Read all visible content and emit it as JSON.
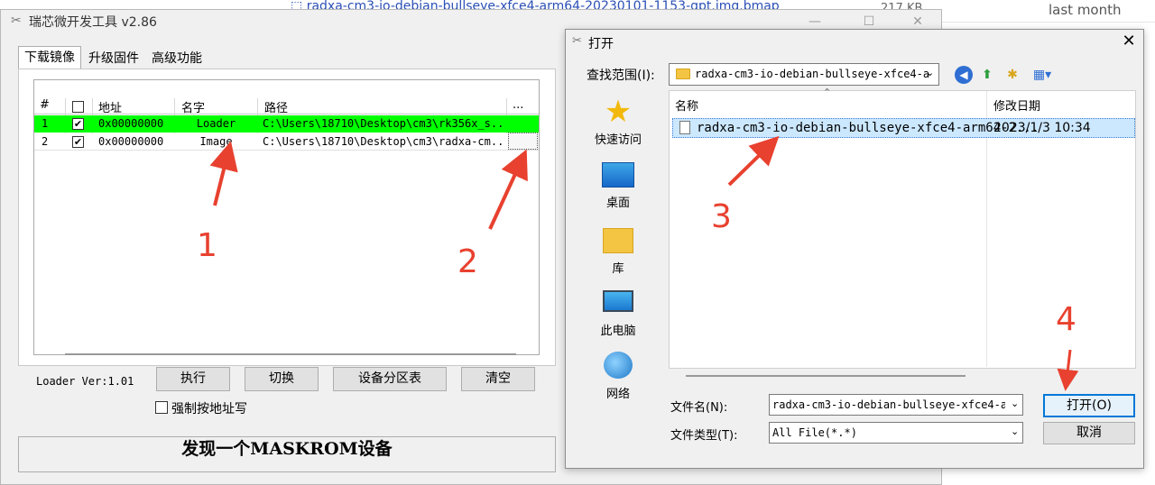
{
  "background": {
    "file_link": "radxa-cm3-io-debian-bullseye-xfce4-arm64-20230101-1153-gpt.img.bmap",
    "file_size": "217 KB",
    "file_date": "last month"
  },
  "tool": {
    "title": "瑞芯微开发工具 v2.86",
    "tabs": [
      "下载镜像",
      "升级固件",
      "高级功能"
    ],
    "columns": [
      "#",
      "地址",
      "名字",
      "路径",
      "..."
    ],
    "rows": [
      {
        "index": "1",
        "checked": "✔",
        "address": "0x00000000",
        "name": "Loader",
        "path": "C:\\Users\\18710\\Desktop\\cm3\\rk356x_s...",
        "highlight": "#00ff00"
      },
      {
        "index": "2",
        "checked": "✔",
        "address": "0x00000000",
        "name": "Image",
        "path": "C:\\Users\\18710\\Desktop\\cm3\\radxa-cm...",
        "highlight": "#ffffff"
      }
    ],
    "loader_version": "Loader Ver:1.01",
    "buttons": {
      "run": "执行",
      "switch": "切换",
      "partition_table": "设备分区表",
      "clear": "清空"
    },
    "force_address_label": "强制按地址写",
    "status": "发现一个MASKROM设备"
  },
  "dialog": {
    "title": "打开",
    "look_in_label": "查找范围(I):",
    "look_in_value": "radxa-cm3-io-debian-bullseye-xfce4-a",
    "places": [
      "快速访问",
      "桌面",
      "库",
      "此电脑",
      "网络"
    ],
    "columns": {
      "name": "名称",
      "date": "修改日期"
    },
    "file": {
      "name": "radxa-cm3-io-debian-bullseye-xfce4-arm64-2...",
      "date": "2023/1/3 10:34"
    },
    "filename_label": "文件名(N):",
    "filename_value": "radxa-cm3-io-debian-bullseye-xfce4-ar",
    "filetype_label": "文件类型(T):",
    "filetype_value": "All File(*.*)",
    "open_button": "打开(O)",
    "cancel_button": "取消"
  },
  "annotations": [
    "1",
    "2",
    "3",
    "4"
  ],
  "colors": {
    "annotation": "#e8412f",
    "selected_row": "#cce8ff",
    "loader_row": "#00ff00"
  }
}
